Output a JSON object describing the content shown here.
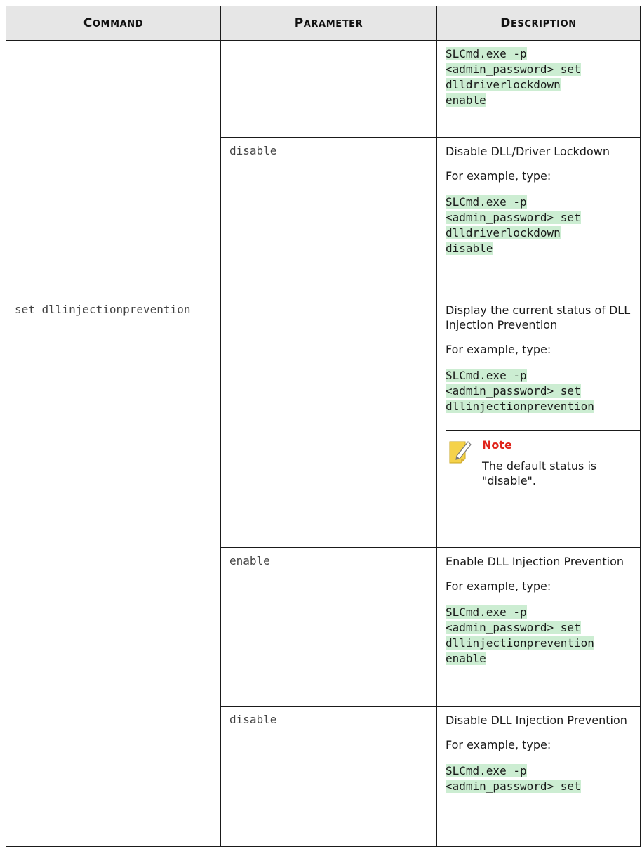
{
  "headers": {
    "command": {
      "first": "C",
      "rest": "OMMAND"
    },
    "parameter": {
      "first": "P",
      "rest": "ARAMETER"
    },
    "description": {
      "first": "D",
      "rest": "ESCRIPTION"
    }
  },
  "row1": {
    "code": [
      "SLCmd.exe -p",
      "<admin_password> set",
      "dlldriverlockdown",
      "enable"
    ]
  },
  "row2": {
    "parameter": "disable",
    "description": "Disable DLL/Driver Lockdown",
    "example": "For example, type:",
    "code": [
      "SLCmd.exe -p",
      "<admin_password> set",
      "dlldriverlockdown",
      "disable"
    ]
  },
  "row3": {
    "command": "set dllinjectionprevention",
    "description": "Display the current status of DLL Injection Prevention",
    "example": "For example, type:",
    "code": [
      "SLCmd.exe -p",
      "<admin_password> set",
      "dllinjectionprevention"
    ],
    "note_title": "Note",
    "note_body": "The default status is \"disable\"."
  },
  "row4": {
    "parameter": "enable",
    "description": "Enable DLL Injection Prevention",
    "example": "For example, type:",
    "code": [
      "SLCmd.exe -p",
      "<admin_password> set",
      "dllinjectionprevention",
      "enable"
    ]
  },
  "row5": {
    "parameter": "disable",
    "description": "Disable DLL Injection Prevention",
    "example": "For example, type:",
    "code": [
      "SLCmd.exe -p",
      "<admin_password> set"
    ]
  },
  "colors": {
    "code_highlight": "#ccedd2",
    "note_title": "#e0241b",
    "header_bg": "#e6e6e6",
    "note_icon": "#f5d24a"
  }
}
